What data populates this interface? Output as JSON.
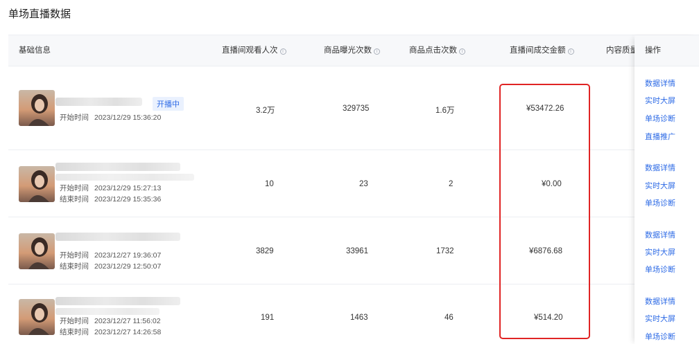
{
  "page_title": "单场直播数据",
  "headers": {
    "basic_info": "基础信息",
    "viewers": "直播间观看人次",
    "exposure": "商品曝光次数",
    "clicks": "商品点击次数",
    "gmv": "直播间成交金额",
    "content_quality": "内容质量",
    "actions": "操作"
  },
  "info_icon": "i",
  "rows": [
    {
      "status": "开播中",
      "start_label": "开始时间",
      "start_time": "2023/12/29 15:36:20",
      "end_label": "",
      "end_time": "",
      "viewers": "3.2万",
      "exposure": "329735",
      "clicks": "1.6万",
      "gmv": "¥53472.26",
      "actions": [
        "数据详情",
        "实时大屏",
        "单场诊断",
        "直播推广"
      ]
    },
    {
      "status": "",
      "start_label": "开始时间",
      "start_time": "2023/12/29 15:27:13",
      "end_label": "结束时间",
      "end_time": "2023/12/29 15:35:36",
      "viewers": "10",
      "exposure": "23",
      "clicks": "2",
      "gmv": "¥0.00",
      "actions": [
        "数据详情",
        "实时大屏",
        "单场诊断"
      ]
    },
    {
      "status": "",
      "start_label": "开始时间",
      "start_time": "2023/12/27 19:36:07",
      "end_label": "结束时间",
      "end_time": "2023/12/29 12:50:07",
      "viewers": "3829",
      "exposure": "33961",
      "clicks": "1732",
      "gmv": "¥6876.68",
      "actions": [
        "数据详情",
        "实时大屏",
        "单场诊断"
      ]
    },
    {
      "status": "",
      "start_label": "开始时间",
      "start_time": "2023/12/27 11:56:02",
      "end_label": "结束时间",
      "end_time": "2023/12/27 14:26:58",
      "viewers": "191",
      "exposure": "1463",
      "clicks": "46",
      "gmv": "¥514.20",
      "actions": [
        "数据详情",
        "实时大屏",
        "单场诊断"
      ]
    }
  ],
  "colors": {
    "link": "#2e6be6",
    "highlight": "#e02424",
    "header_bg": "#f7f8fa"
  }
}
